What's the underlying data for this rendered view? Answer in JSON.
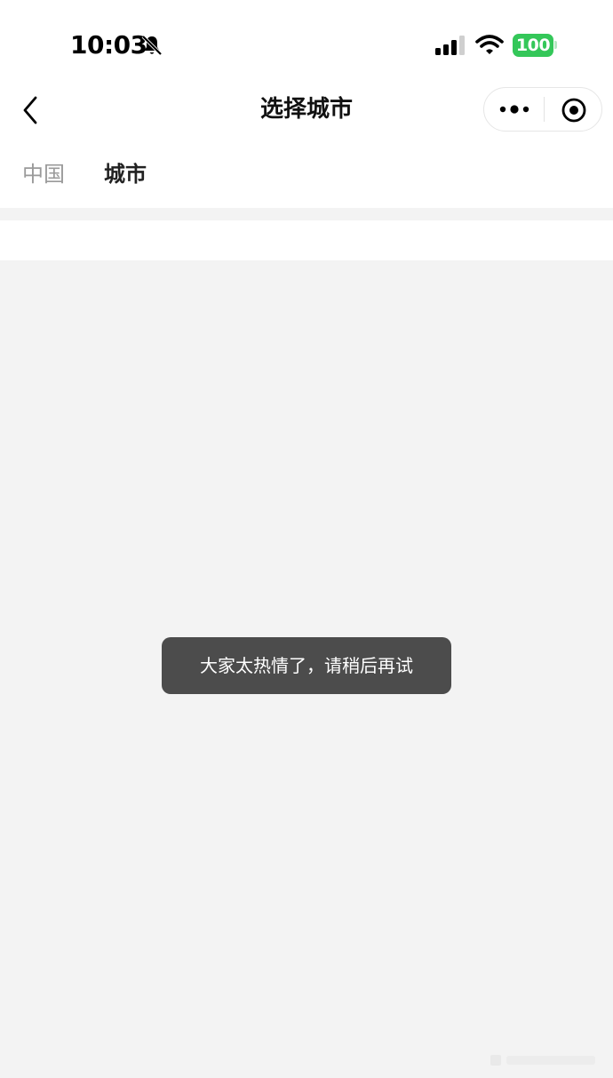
{
  "status_bar": {
    "time": "10:03",
    "battery": "100",
    "battery_color": "#34c759"
  },
  "nav": {
    "title": "选择城市",
    "back_icon": "chevron-left-icon",
    "more_icon": "more-dots-icon",
    "close_icon": "target-close-icon"
  },
  "tabs": [
    {
      "label": "中国",
      "selected": false
    },
    {
      "label": "城市",
      "selected": true
    }
  ],
  "toast": {
    "message": "大家太热情了，请稍后再试"
  },
  "colors": {
    "page_background": "#f3f3f3",
    "toast_background": "#4c4c4c",
    "tab_inactive": "#9a9a9a",
    "tab_active": "#222222"
  }
}
